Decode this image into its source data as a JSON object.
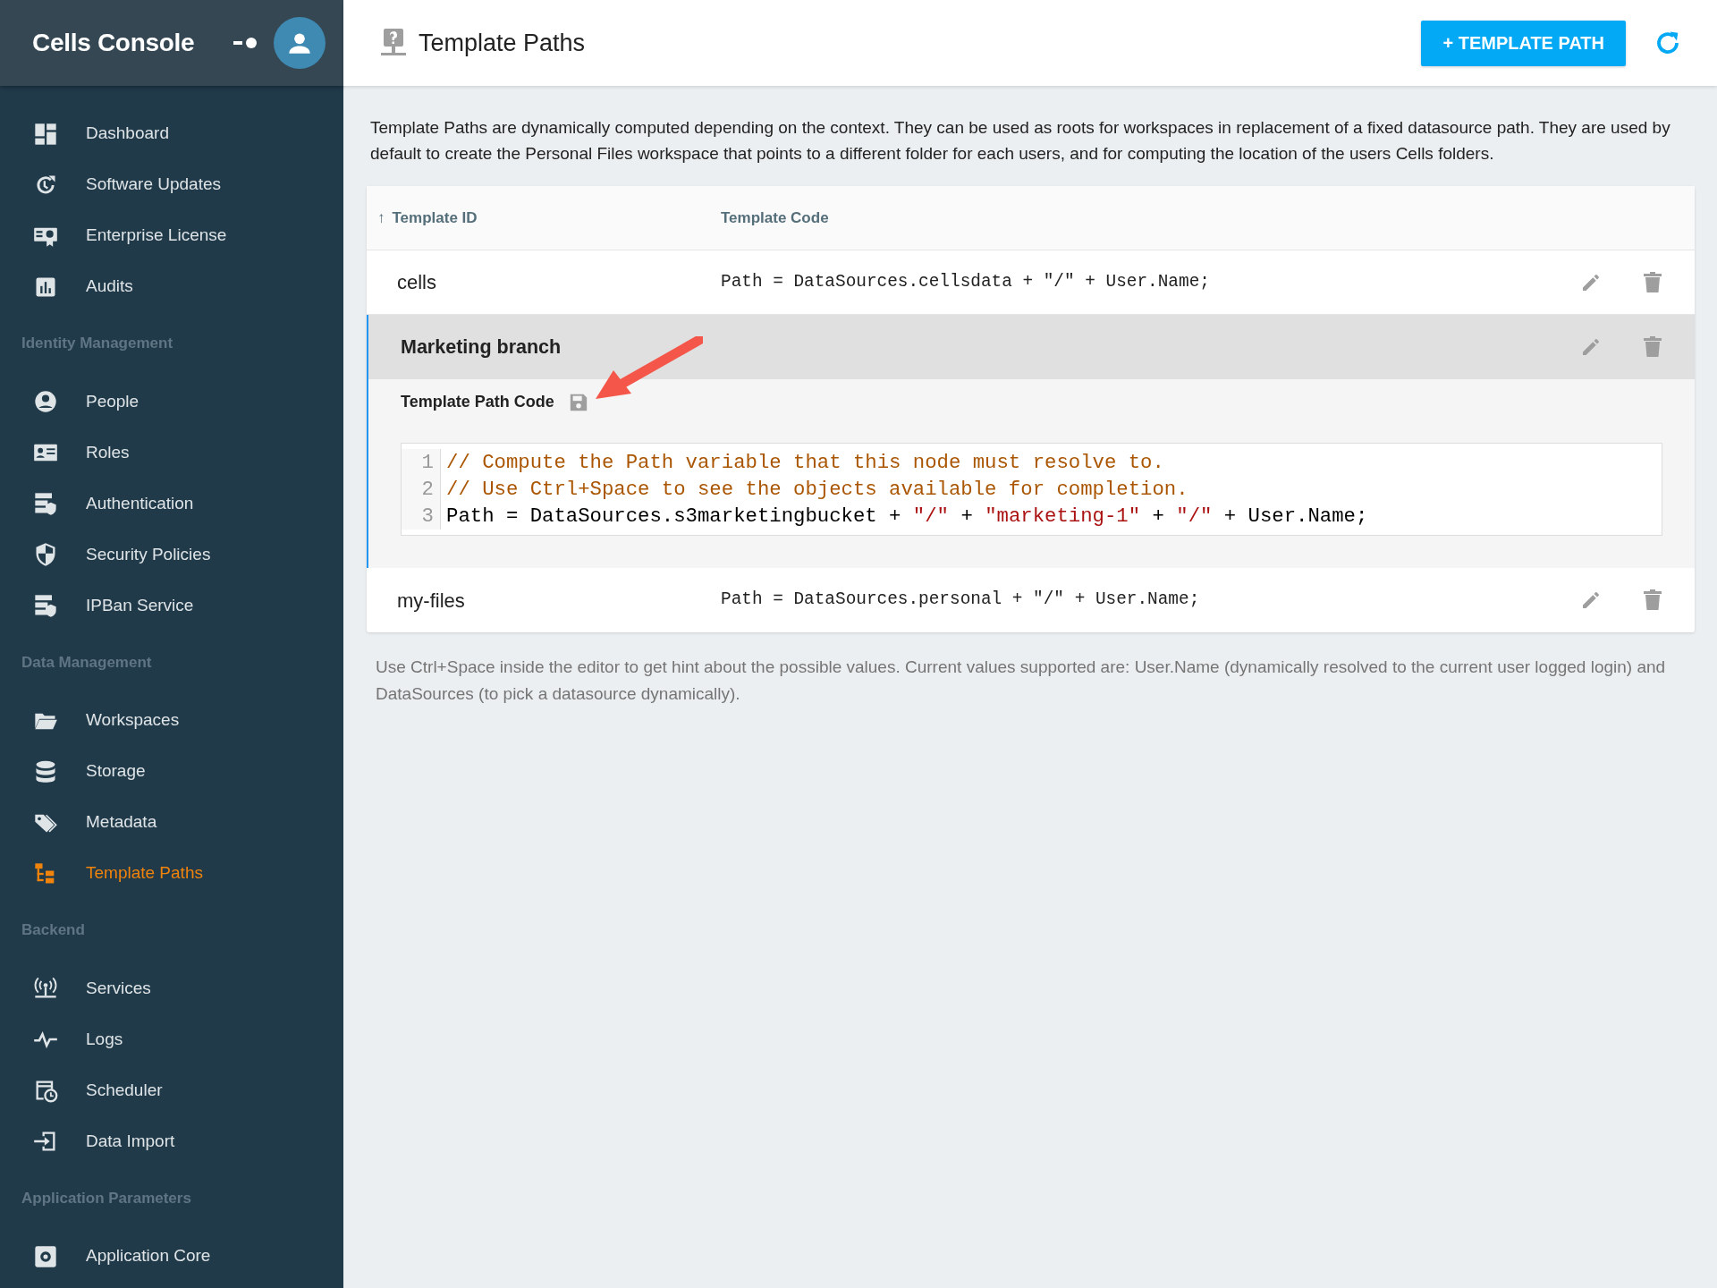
{
  "sidebar": {
    "title": "Cells Console",
    "sections": [
      {
        "items": [
          {
            "label": "Dashboard",
            "selected": false
          },
          {
            "label": "Software Updates",
            "selected": false
          },
          {
            "label": "Enterprise License",
            "selected": false
          },
          {
            "label": "Audits",
            "selected": false
          }
        ]
      },
      {
        "heading": "Identity Management",
        "items": [
          {
            "label": "People",
            "selected": false
          },
          {
            "label": "Roles",
            "selected": false
          },
          {
            "label": "Authentication",
            "selected": false
          },
          {
            "label": "Security Policies",
            "selected": false
          },
          {
            "label": "IPBan Service",
            "selected": false
          }
        ]
      },
      {
        "heading": "Data Management",
        "items": [
          {
            "label": "Workspaces",
            "selected": false
          },
          {
            "label": "Storage",
            "selected": false
          },
          {
            "label": "Metadata",
            "selected": false
          },
          {
            "label": "Template Paths",
            "selected": true
          }
        ]
      },
      {
        "heading": "Backend",
        "items": [
          {
            "label": "Services",
            "selected": false
          },
          {
            "label": "Logs",
            "selected": false
          },
          {
            "label": "Scheduler",
            "selected": false
          },
          {
            "label": "Data Import",
            "selected": false
          }
        ]
      },
      {
        "heading": "Application Parameters",
        "items": [
          {
            "label": "Application Core",
            "selected": false
          }
        ]
      }
    ]
  },
  "header": {
    "title": "Template Paths",
    "add_button": "+ TEMPLATE PATH"
  },
  "description": "Template Paths are dynamically computed depending on the context. They can be used as roots for workspaces in replacement of a fixed datasource path. They are used by default to create the Personal Files workspace that points to a different folder for each users, and for computing the location of the users Cells folders.",
  "table": {
    "sort_indicator": "↑",
    "columns": [
      "Template ID",
      "Template Code"
    ],
    "rows": [
      {
        "id": "cells",
        "code": "Path = DataSources.cellsdata + \"/\" + User.Name;",
        "expanded": false
      },
      {
        "id": "Marketing branch",
        "expanded": true,
        "editor_label": "Template Path Code",
        "code_lines": [
          {
            "number": "1",
            "tokens": [
              {
                "text": "// Compute the Path variable that this node must resolve to.",
                "kind": "comment"
              }
            ]
          },
          {
            "number": "2",
            "tokens": [
              {
                "text": "// Use Ctrl+Space to see the objects available for completion.",
                "kind": "comment"
              }
            ]
          },
          {
            "number": "3",
            "tokens": [
              {
                "text": "Path = DataSources.s3marketingbucket + ",
                "kind": "plain"
              },
              {
                "text": "\"/\"",
                "kind": "string"
              },
              {
                "text": " + ",
                "kind": "plain"
              },
              {
                "text": "\"marketing-1\"",
                "kind": "string"
              },
              {
                "text": " + ",
                "kind": "plain"
              },
              {
                "text": "\"/\"",
                "kind": "string"
              },
              {
                "text": " + User.Name;",
                "kind": "plain"
              }
            ]
          }
        ]
      },
      {
        "id": "my-files",
        "code": "Path = DataSources.personal + \"/\" + User.Name;",
        "expanded": false
      }
    ]
  },
  "hint": "Use Ctrl+Space inside the editor to get hint about the possible values. Current values supported are: User.Name (dynamically resolved to the current user logged login) and DataSources (to pick a datasource dynamically)."
}
